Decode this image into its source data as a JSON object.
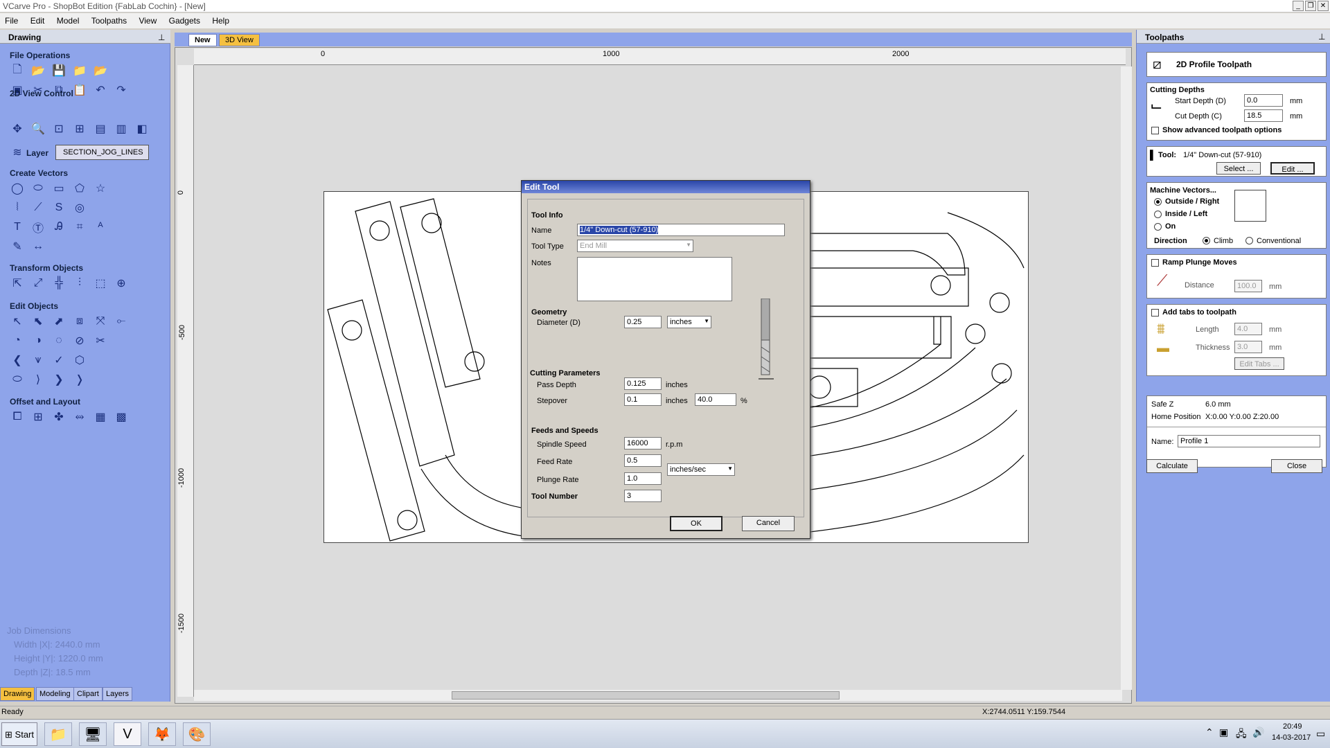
{
  "window": {
    "title": "VCarve Pro - ShopBot Edition {FabLab Cochin} - [New]"
  },
  "menu": [
    "File",
    "Edit",
    "Model",
    "Toolpaths",
    "View",
    "Gadgets",
    "Help"
  ],
  "left_panel": {
    "title": "Drawing",
    "sections": {
      "file_ops": "File Operations",
      "view_2d": "2D View Control",
      "layer_label": "Layer",
      "layer_value": "SECTION_JOG_LINES",
      "create_vectors": "Create Vectors",
      "transform": "Transform Objects",
      "edit_objects": "Edit Objects",
      "offset_layout": "Offset and Layout"
    },
    "job": {
      "title": "Job Dimensions",
      "width": "Width  |X|: 2440.0 mm",
      "height": "Height |Y|: 1220.0 mm",
      "depth": "Depth  |Z|: 18.5 mm"
    },
    "tabs": [
      "Drawing",
      "Modeling",
      "Clipart",
      "Layers"
    ]
  },
  "doc_tabs": [
    "New",
    "3D View"
  ],
  "ruler": {
    "h": [
      "0",
      "1000",
      "2000"
    ],
    "v": [
      "0",
      "-500",
      "-1000",
      "-1500"
    ]
  },
  "right_panel": {
    "title": "Toolpaths",
    "toolpath_name": "2D Profile Toolpath",
    "cutting_depths": "Cutting Depths",
    "start_depth_label": "Start Depth (D)",
    "start_depth": "0.0",
    "cut_depth_label": "Cut Depth (C)",
    "cut_depth": "18.5",
    "unit_mm": "mm",
    "show_advanced": "Show advanced toolpath options",
    "tool_label": "Tool:",
    "tool_value": "1/4\"  Down-cut (57-910)",
    "select_btn": "Select ...",
    "edit_btn": "Edit ...",
    "machine_vectors": "Machine Vectors...",
    "outside": "Outside / Right",
    "inside": "Inside / Left",
    "on": "On",
    "direction": "Direction",
    "climb": "Climb",
    "conventional": "Conventional",
    "ramp": "Ramp Plunge Moves",
    "distance_label": "Distance",
    "distance": "100.0",
    "add_tabs": "Add tabs to toolpath",
    "length_label": "Length",
    "length": "4.0",
    "thickness_label": "Thickness",
    "thickness": "3.0",
    "edit_tabs": "Edit Tabs ...",
    "safe_z_label": "Safe Z",
    "safe_z": "6.0 mm",
    "home_label": "Home Position",
    "home": "X:0.00 Y:0.00 Z:20.00",
    "name_label": "Name:",
    "name": "Profile 1",
    "calculate": "Calculate",
    "close": "Close"
  },
  "dialog": {
    "title": "Edit Tool",
    "tool_info": "Tool Info",
    "name_label": "Name",
    "name": "1/4\"  Down-cut (57-910)",
    "tool_type_label": "Tool Type",
    "tool_type": "End Mill",
    "notes_label": "Notes",
    "geometry": "Geometry",
    "diameter_label": "Diameter (D)",
    "diameter": "0.25",
    "diameter_unit": "inches",
    "cutting_params": "Cutting Parameters",
    "pass_depth_label": "Pass Depth",
    "pass_depth": "0.125",
    "inches": "inches",
    "stepover_label": "Stepover",
    "stepover": "0.1",
    "stepover_pct": "40.0",
    "pct": "%",
    "feeds": "Feeds and Speeds",
    "spindle_label": "Spindle Speed",
    "spindle": "16000",
    "rpm": "r.p.m",
    "feed_label": "Feed Rate",
    "feed": "0.5",
    "rate_unit": "inches/sec",
    "plunge_label": "Plunge Rate",
    "plunge": "1.0",
    "tool_number_label": "Tool Number",
    "tool_number": "3",
    "ok": "OK",
    "cancel": "Cancel"
  },
  "status": {
    "left": "Ready",
    "coords": "X:2744.0511 Y:159.7544"
  },
  "taskbar": {
    "start": "Start",
    "time": "20:49",
    "date": "14-03-2017"
  }
}
